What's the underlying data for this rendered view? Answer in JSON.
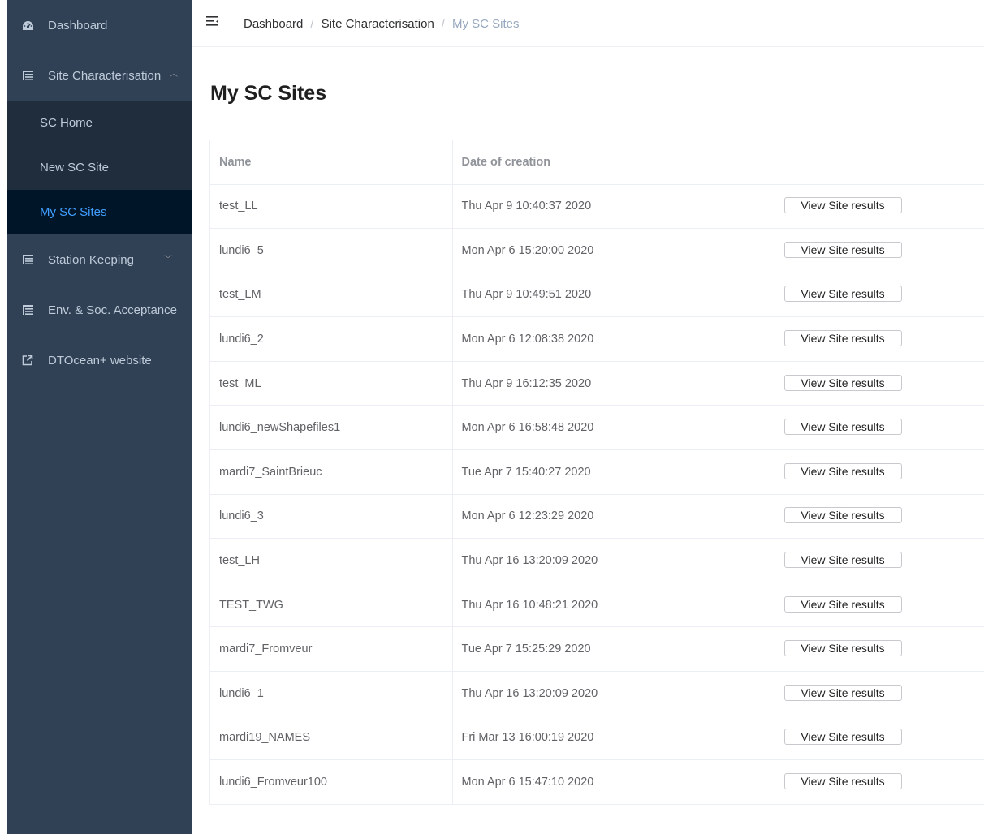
{
  "sidebar": {
    "dashboard": "Dashboard",
    "site_characterisation": "Site Characterisation",
    "sc_items": [
      "SC Home",
      "New SC Site",
      "My SC Sites"
    ],
    "station_keeping": "Station Keeping",
    "env_soc": "Env. & Soc. Acceptance",
    "website": "DTOcean+ website"
  },
  "breadcrumb": {
    "items": [
      "Dashboard",
      "Site Characterisation"
    ],
    "current": "My SC Sites",
    "separator": "/"
  },
  "page": {
    "title": "My SC Sites"
  },
  "table": {
    "headers": [
      "Name",
      "Date of creation",
      ""
    ],
    "button_label": "View Site results",
    "rows": [
      {
        "name": "test_LL",
        "date": "Thu Apr 9 10:40:37 2020"
      },
      {
        "name": "lundi6_5",
        "date": "Mon Apr 6 15:20:00 2020"
      },
      {
        "name": "test_LM",
        "date": "Thu Apr 9 10:49:51 2020"
      },
      {
        "name": "lundi6_2",
        "date": "Mon Apr 6 12:08:38 2020"
      },
      {
        "name": "test_ML",
        "date": "Thu Apr 9 16:12:35 2020"
      },
      {
        "name": "lundi6_newShapefiles1",
        "date": "Mon Apr 6 16:58:48 2020"
      },
      {
        "name": "mardi7_SaintBrieuc",
        "date": "Tue Apr 7 15:40:27 2020"
      },
      {
        "name": "lundi6_3",
        "date": "Mon Apr 6 12:23:29 2020"
      },
      {
        "name": "test_LH",
        "date": "Thu Apr 16 13:20:09 2020"
      },
      {
        "name": "TEST_TWG",
        "date": "Thu Apr 16 10:48:21 2020"
      },
      {
        "name": "mardi7_Fromveur",
        "date": "Tue Apr 7 15:25:29 2020"
      },
      {
        "name": "lundi6_1",
        "date": "Thu Apr 16 13:20:09 2020"
      },
      {
        "name": "mardi19_NAMES",
        "date": "Fri Mar 13 16:00:19 2020"
      },
      {
        "name": "lundi6_Fromveur100",
        "date": "Mon Apr 6 15:47:10 2020"
      }
    ]
  },
  "colors": {
    "sidebar_bg": "#304156",
    "submenu_bg": "#1f2d3d",
    "active_bg": "#001528",
    "accent": "#409eff"
  }
}
